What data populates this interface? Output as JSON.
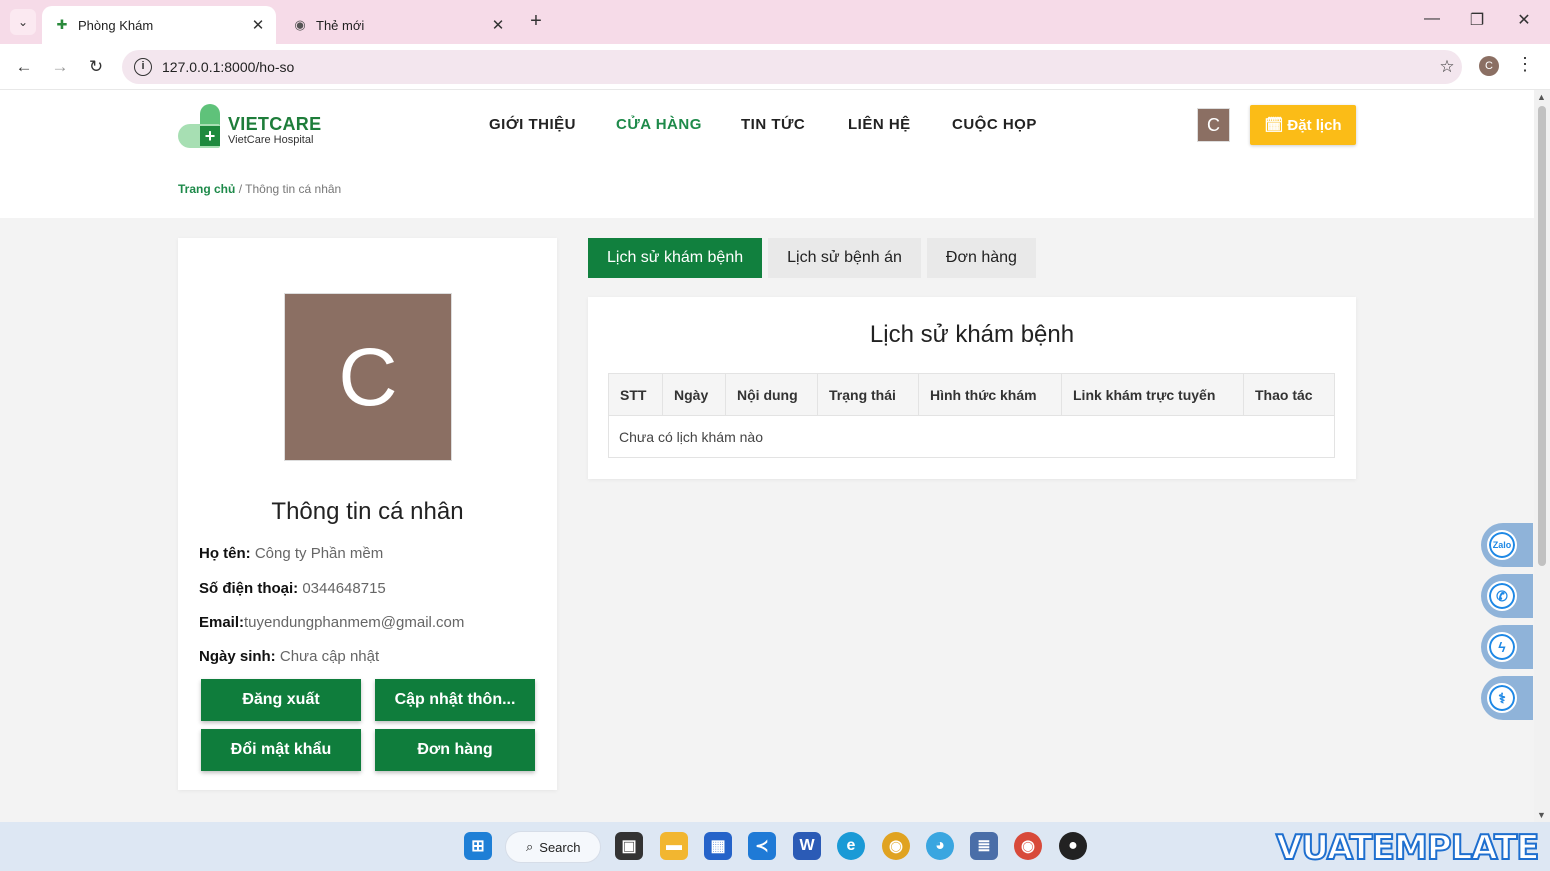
{
  "browser": {
    "tabs": [
      {
        "title": "Phòng Khám",
        "active": true
      },
      {
        "title": "Thẻ mới",
        "active": false
      }
    ],
    "url": "127.0.0.1:8000/ho-so",
    "profile_initial": "C"
  },
  "header": {
    "logo_title": "VIETCARE",
    "logo_subtitle": "VietCare Hospital",
    "menu": [
      "GIỚI THIỆU",
      "CỬA HÀNG",
      "TIN TỨC",
      "LIÊN HỆ",
      "CUỘC HỌP"
    ],
    "active_menu": "CỬA HÀNG",
    "user_initial": "C",
    "book_button": "Đặt lịch"
  },
  "breadcrumb": {
    "home": "Trang chủ",
    "separator": "/",
    "current": "Thông tin cá nhân"
  },
  "profile": {
    "avatar_initial": "C",
    "title": "Thông tin cá nhân",
    "fields": [
      {
        "label": "Họ tên:",
        "value": "Công ty Phần mềm"
      },
      {
        "label": "Số điện thoại:",
        "value": "0344648715"
      },
      {
        "label": "Email:",
        "value": "tuyendungphanmem@gmail.com"
      },
      {
        "label": "Ngày sinh:",
        "value": "Chưa cập nhật"
      }
    ],
    "buttons": [
      "Đăng xuất",
      "Cập nhật thôn...",
      "Đổi mật khẩu",
      "Đơn hàng"
    ]
  },
  "content": {
    "tabs": [
      "Lịch sử khám bệnh",
      "Lịch sử bệnh án",
      "Đơn hàng"
    ],
    "active_tab": "Lịch sử khám bệnh",
    "title": "Lịch sử khám bệnh",
    "table": {
      "columns": [
        "STT",
        "Ngày",
        "Nội dung",
        "Trạng thái",
        "Hình thức khám",
        "Link khám trực tuyến",
        "Thao tác"
      ],
      "empty_message": "Chưa có lịch khám nào"
    }
  },
  "floating": [
    "zalo-icon",
    "phone-icon",
    "messenger-icon",
    "stethoscope-icon"
  ],
  "taskbar": {
    "search_label": "Search",
    "watermark": "VUATEMPLATE"
  },
  "colors": {
    "primary_green": "#0f7d3c",
    "accent_yellow": "#fbbc17",
    "avatar_brown": "#8b6f63",
    "tabbar_pink": "#f6dbe8"
  }
}
